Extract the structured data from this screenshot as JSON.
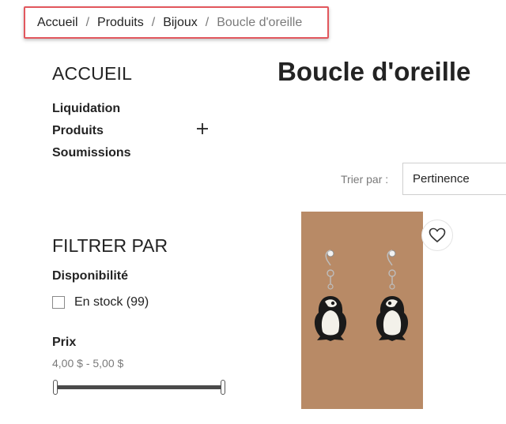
{
  "breadcrumb": {
    "items": [
      "Accueil",
      "Produits",
      "Bijoux"
    ],
    "current": "Boucle d'oreille",
    "separator": "/"
  },
  "nav": {
    "title": "ACCUEIL",
    "items": [
      "Liquidation",
      "Produits",
      "Soumissions"
    ]
  },
  "filters": {
    "title": "FILTRER PAR",
    "availability": {
      "label": "Disponibilité",
      "option": "En stock (99)",
      "checked": false
    },
    "price": {
      "label": "Prix",
      "range": "4,00 $ - 5,00 $",
      "slider_min_fraction": 0,
      "slider_max_fraction": 1
    }
  },
  "main": {
    "title": "Boucle d'oreille",
    "sort": {
      "label": "Trier par :",
      "value": "Pertinence"
    }
  },
  "product": {
    "image_icon": "penguin-earrings",
    "wishlist_icon": "heart-icon",
    "background_color": "#b88a66"
  },
  "colors": {
    "accent_border": "#e2575d",
    "text": "#232323",
    "muted": "#7a7a7a"
  }
}
